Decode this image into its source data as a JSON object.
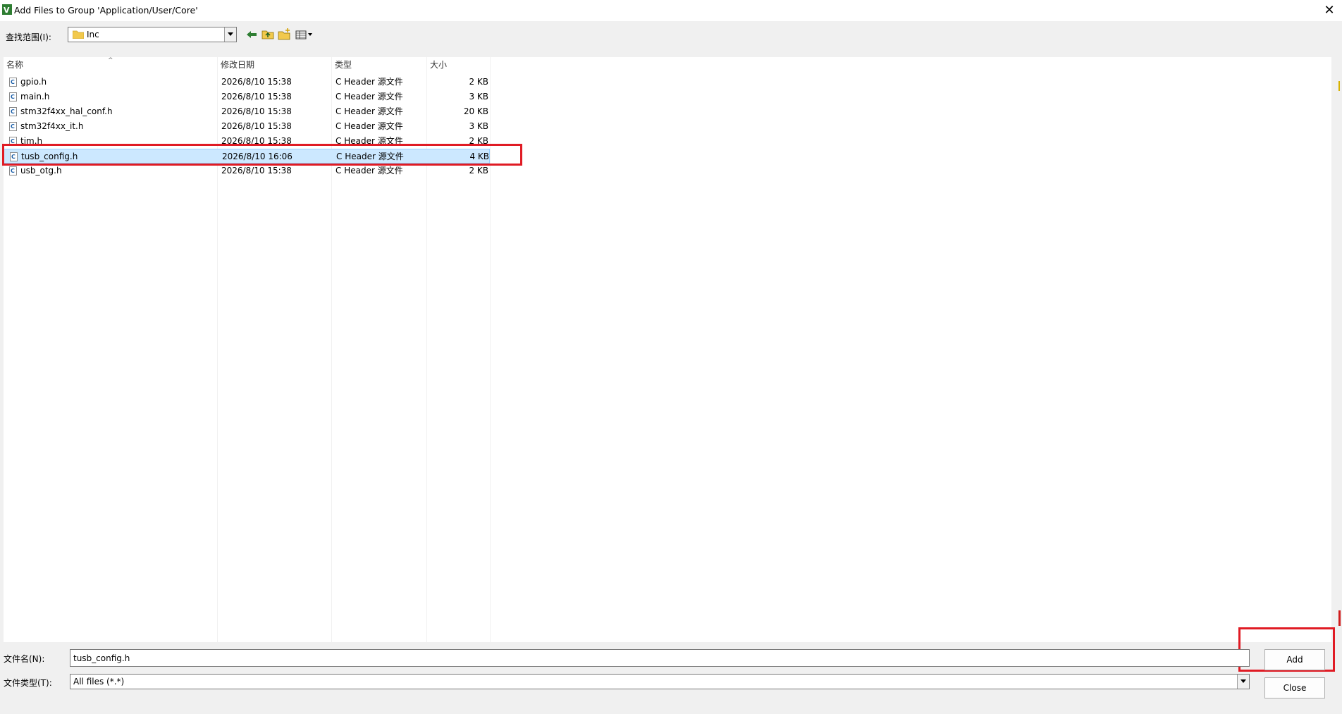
{
  "window": {
    "title": "Add Files to Group 'Application/User/Core'",
    "close_glyph": "✕"
  },
  "lookin": {
    "label": "查找范围(I):",
    "value": "Inc"
  },
  "columns": [
    "名称",
    "修改日期",
    "类型",
    "大小"
  ],
  "files": [
    {
      "name": "gpio.h",
      "date": "2026/8/10 15:38",
      "type": "C Header 源文件",
      "size": "2 KB",
      "selected": false
    },
    {
      "name": "main.h",
      "date": "2026/8/10 15:38",
      "type": "C Header 源文件",
      "size": "3 KB",
      "selected": false
    },
    {
      "name": "stm32f4xx_hal_conf.h",
      "date": "2026/8/10 15:38",
      "type": "C Header 源文件",
      "size": "20 KB",
      "selected": false
    },
    {
      "name": "stm32f4xx_it.h",
      "date": "2026/8/10 15:38",
      "type": "C Header 源文件",
      "size": "3 KB",
      "selected": false
    },
    {
      "name": "tim.h",
      "date": "2026/8/10 15:38",
      "type": "C Header 源文件",
      "size": "2 KB",
      "selected": false
    },
    {
      "name": "tusb_config.h",
      "date": "2026/8/10 16:06",
      "type": "C Header 源文件",
      "size": "4 KB",
      "selected": true
    },
    {
      "name": "usb_otg.h",
      "date": "2026/8/10 15:38",
      "type": "C Header 源文件",
      "size": "2 KB",
      "selected": false
    }
  ],
  "filename": {
    "label": "文件名(N):",
    "value": "tusb_config.h"
  },
  "filetype": {
    "label": "文件类型(T):",
    "value": "All files (*.*)"
  },
  "buttons": {
    "add": "Add",
    "close": "Close"
  },
  "colors": {
    "selection": "#cce8ff",
    "annotation": "#e01b24"
  }
}
